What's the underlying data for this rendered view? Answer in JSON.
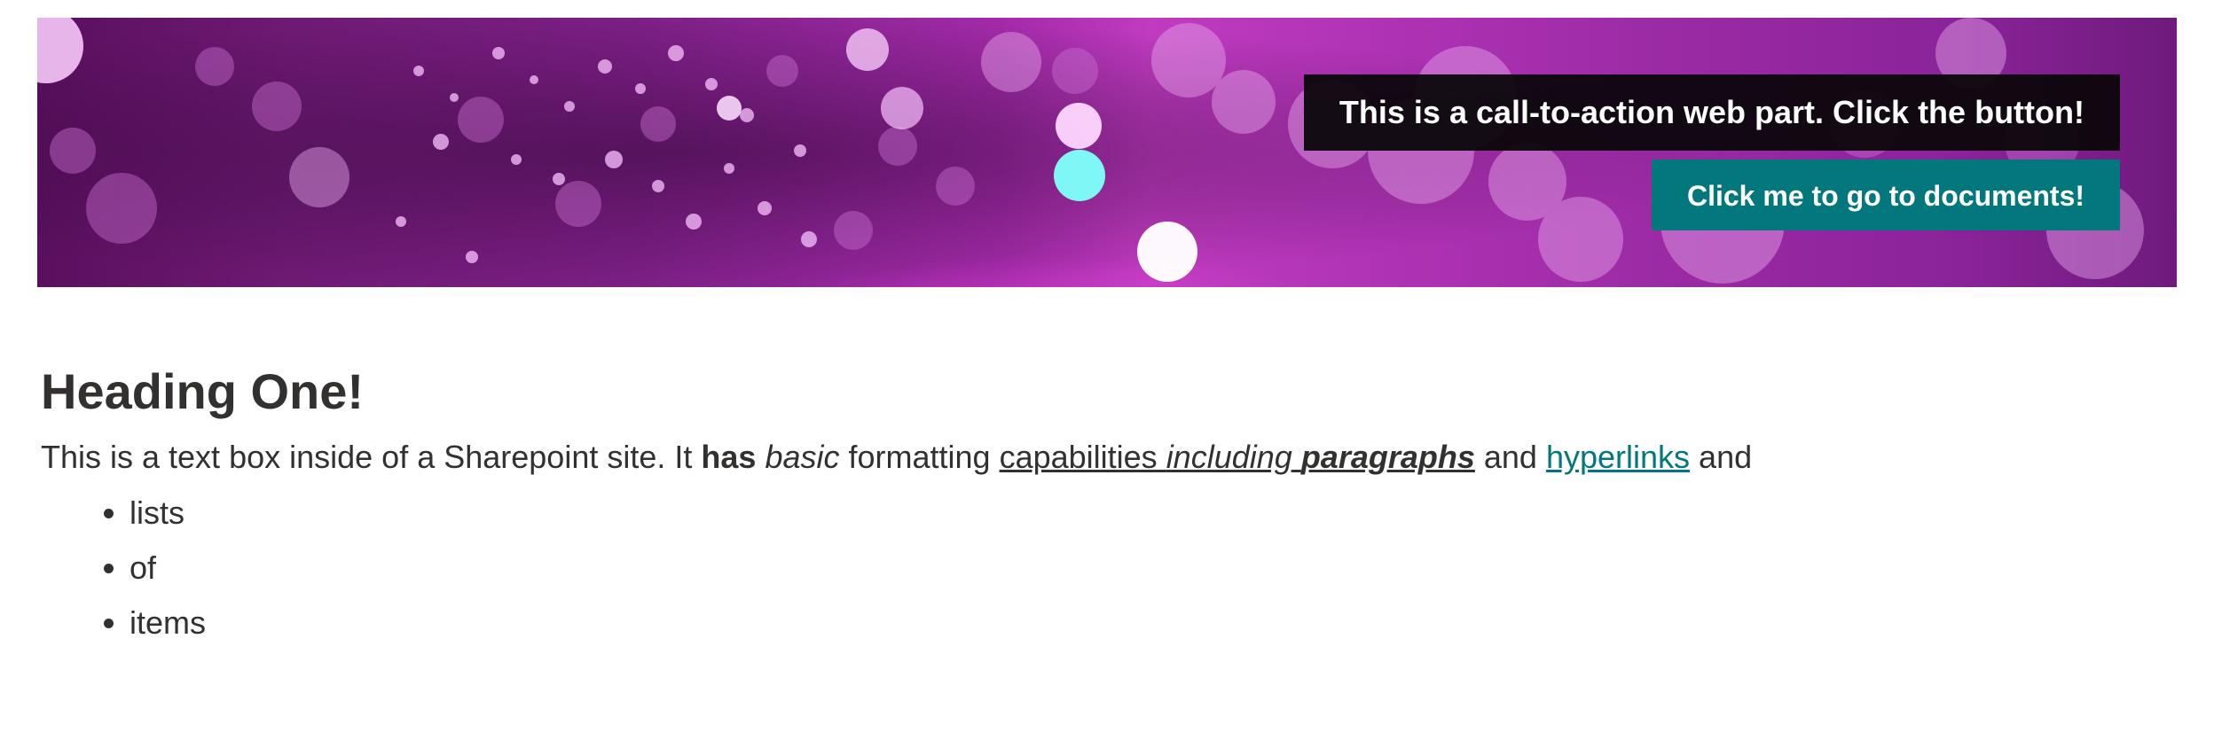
{
  "banner": {
    "cta_text": "This is a call-to-action web part. Click the button!",
    "button_label": "Click me to go to documents!",
    "colors": {
      "overlay": "#0a060a",
      "button": "#03787c",
      "bokeh_cyan": "#7ff7f7"
    }
  },
  "content": {
    "heading": "Heading One!",
    "paragraph": {
      "t1": "This is a text box inside of a Sharepoint site. It ",
      "bold": "has",
      "italic": "basic",
      "t2": " formatting ",
      "u1": "capabilities ",
      "u_italic": "including",
      "u_bold_italic": "paragraphs",
      "t3": " and ",
      "link": "hyperlinks",
      "t4": " and"
    },
    "list_items": [
      "lists",
      "of",
      "items"
    ],
    "link_color": "#03787c"
  }
}
